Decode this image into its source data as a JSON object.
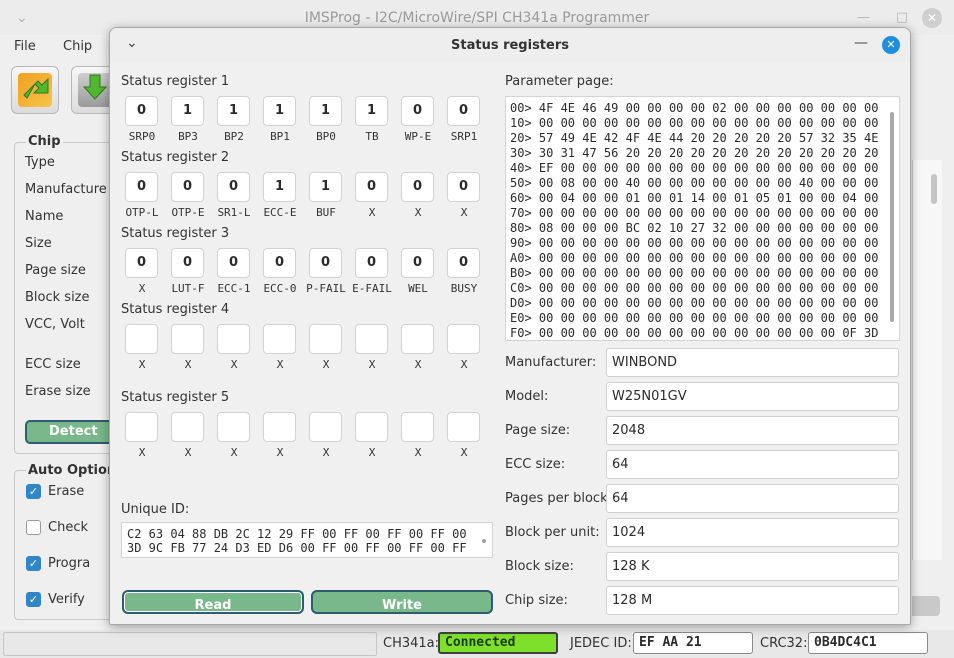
{
  "main_window": {
    "title": "IMSProg - I2C/MicroWire/SPI CH341a Programmer",
    "titlebar_menu_glyph": "⌄",
    "min_glyph": "—",
    "max_glyph": "□",
    "close_glyph": "✕",
    "menu": [
      "File",
      "Chip"
    ],
    "chip_group": {
      "title": "Chip",
      "labels": [
        "Type",
        "Manufacture",
        "Name",
        "Size",
        "Page size",
        "Block size",
        "VCC, Volt",
        "ECC size",
        "Erase size"
      ],
      "detect_label": "Detect"
    },
    "auto_options": {
      "title": "Auto Options",
      "items": [
        {
          "label": "Erase",
          "checked": true
        },
        {
          "label": "Check",
          "checked": false
        },
        {
          "label": "Progra",
          "checked": true
        },
        {
          "label": "Verify",
          "checked": true
        }
      ]
    },
    "status_bar": {
      "adapter_label": "CH341a:",
      "adapter_status": "Connected",
      "jedec_label": "JEDEC ID:",
      "jedec_value": "EF AA 21",
      "crc_label": "CRC32:",
      "crc_value": "0B4DC4C1"
    }
  },
  "dialog": {
    "title": "Status registers",
    "menu_glyph": "⌄",
    "min_glyph": "—",
    "close_glyph": "✕",
    "registers": [
      {
        "title": "Status register 1",
        "values": [
          "0",
          "1",
          "1",
          "1",
          "1",
          "1",
          "0",
          "0"
        ],
        "names": [
          "SRP0",
          "BP3",
          "BP2",
          "BP1",
          "BP0",
          "TB",
          "WP-E",
          "SRP1"
        ]
      },
      {
        "title": "Status register 2",
        "values": [
          "0",
          "0",
          "0",
          "1",
          "1",
          "0",
          "0",
          "0"
        ],
        "names": [
          "OTP-L",
          "OTP-E",
          "SR1-L",
          "ECC-E",
          "BUF",
          "X",
          "X",
          "X"
        ]
      },
      {
        "title": "Status register 3",
        "values": [
          "0",
          "0",
          "0",
          "0",
          "0",
          "0",
          "0",
          "0"
        ],
        "names": [
          "X",
          "LUT-F",
          "ECC-1",
          "ECC-0",
          "P-FAIL",
          "E-FAIL",
          "WEL",
          "BUSY"
        ]
      },
      {
        "title": "Status register 4",
        "values": [
          "",
          "",
          "",
          "",
          "",
          "",
          "",
          ""
        ],
        "names": [
          "X",
          "X",
          "X",
          "X",
          "X",
          "X",
          "X",
          "X"
        ]
      },
      {
        "title": "Status register 5",
        "values": [
          "",
          "",
          "",
          "",
          "",
          "",
          "",
          ""
        ],
        "names": [
          "X",
          "X",
          "X",
          "X",
          "X",
          "X",
          "X",
          "X"
        ]
      }
    ],
    "unique_id": {
      "label": "Unique ID:",
      "lines": [
        "C2 63 04 88 DB 2C 12 29 FF 00 FF 00 FF 00 FF 00",
        "3D 9C FB 77 24 D3 ED D6 00 FF 00 FF 00 FF 00 FF"
      ]
    },
    "buttons": {
      "read": "Read",
      "write": "Write"
    },
    "parameter_page": {
      "label": "Parameter page:",
      "lines": [
        "00> 4F 4E 46 49 00 00 00 00 02 00 00 00 00 00 00 00",
        "10> 00 00 00 00 00 00 00 00 00 00 00 00 00 00 00 00",
        "20> 57 49 4E 42 4F 4E 44 20 20 20 20 20 57 32 35 4E",
        "30> 30 31 47 56 20 20 20 20 20 20 20 20 20 20 20 20",
        "40> EF 00 00 00 00 00 00 00 00 00 00 00 00 00 00 00",
        "50> 00 08 00 00 40 00 00 00 00 00 00 00 40 00 00 00",
        "60> 00 04 00 00 01 00 01 14 00 01 05 01 00 00 04 00",
        "70> 00 00 00 00 00 00 00 00 00 00 00 00 00 00 00 00",
        "80> 08 00 00 00 BC 02 10 27 32 00 00 00 00 00 00 00",
        "90> 00 00 00 00 00 00 00 00 00 00 00 00 00 00 00 00",
        "A0> 00 00 00 00 00 00 00 00 00 00 00 00 00 00 00 00",
        "B0> 00 00 00 00 00 00 00 00 00 00 00 00 00 00 00 00",
        "C0> 00 00 00 00 00 00 00 00 00 00 00 00 00 00 00 00",
        "D0> 00 00 00 00 00 00 00 00 00 00 00 00 00 00 00 00",
        "E0> 00 00 00 00 00 00 00 00 00 00 00 00 00 00 00 00",
        "F0> 00 00 00 00 00 00 00 00 00 00 00 00 00 00 0F 3D"
      ]
    },
    "params": [
      {
        "label": "Manufacturer:",
        "value": "WINBOND"
      },
      {
        "label": "Model:",
        "value": "W25N01GV"
      },
      {
        "label": "Page size:",
        "value": "2048"
      },
      {
        "label": "ECC size:",
        "value": "64"
      },
      {
        "label": "Pages per block:",
        "value": "64"
      },
      {
        "label": "Block per unit:",
        "value": "1024"
      },
      {
        "label": "Block size:",
        "value": "128 K"
      },
      {
        "label": "Chip size:",
        "value": "128 M"
      }
    ]
  }
}
